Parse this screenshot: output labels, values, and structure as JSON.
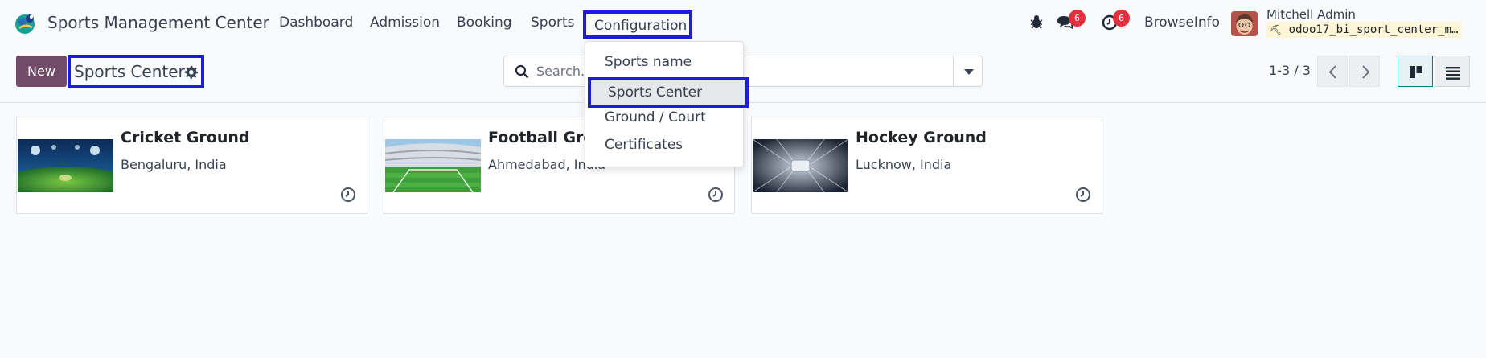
{
  "navbar": {
    "app_title": "Sports Management Center",
    "menu": [
      "Dashboard",
      "Admission",
      "Booking",
      "Sports",
      "Configuration"
    ],
    "messages_count": "6",
    "activities_count": "6",
    "company": "BrowseInfo",
    "user_name": "Mitchell Admin",
    "database": "odoo17_bi_sport_center_m…"
  },
  "control": {
    "new_label": "New",
    "breadcrumb": "Sports Center",
    "search_placeholder": "Search...",
    "pager": "1-3 / 3"
  },
  "dropdown": {
    "items": [
      "Sports name",
      "Sports Center",
      "Ground / Court",
      "Certificates"
    ],
    "active_index": 1
  },
  "cards": [
    {
      "title": "Cricket Ground",
      "location": "Bengaluru, India"
    },
    {
      "title": "Football Ground",
      "location": "Ahmedabad, India"
    },
    {
      "title": "Hockey Ground",
      "location": "Lucknow, India"
    }
  ],
  "colors": {
    "brand": "#714b67",
    "highlight": "#1d1dd8",
    "badge": "#e0323c"
  }
}
